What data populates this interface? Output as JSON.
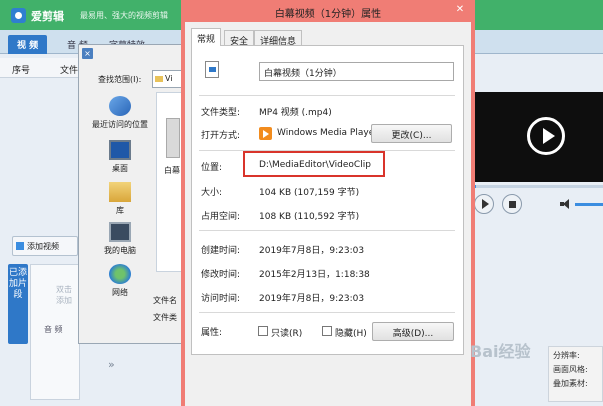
{
  "app": {
    "name": "爱剪辑",
    "slogan": "最易用、强大的视频剪辑",
    "tabs": [
      "视 频",
      "音 频",
      "字幕特效"
    ],
    "columns": {
      "seq": "序号",
      "file": "文件"
    },
    "add_video": "添加视频",
    "added_clips": "已添加片段",
    "dblclick_hint": "双击 添加",
    "audio_label": "音 频",
    "expand_arrows": "»",
    "info_rows": [
      "分辨率:",
      "画面风格:",
      "叠加素材:"
    ]
  },
  "open_dialog": {
    "lookin_label": "查找范围(I):",
    "lookin_value": "Vi",
    "places": [
      {
        "label": "最近访问的位置",
        "icon": "recent-places-icon"
      },
      {
        "label": "桌面",
        "icon": "desktop-icon"
      },
      {
        "label": "库",
        "icon": "library-icon"
      },
      {
        "label": "我的电脑",
        "icon": "computer-icon"
      },
      {
        "label": "网络",
        "icon": "network-icon"
      }
    ],
    "file_thumb_name": "白幕",
    "filename_label": "文件名",
    "filetype_label": "文件类"
  },
  "properties": {
    "title": "白幕视频（1分钟）属性",
    "tabs": [
      "常规",
      "安全",
      "详细信息"
    ],
    "file_name": "白幕视频（1分钟）",
    "file_type_label": "文件类型:",
    "file_type": "MP4 视频 (.mp4)",
    "opens_with_label": "打开方式:",
    "opens_with": "Windows Media Playe",
    "change_button": "更改(C)...",
    "location_label": "位置:",
    "location": "D:\\MediaEditor\\VideoClip",
    "size_label": "大小:",
    "size": "104 KB (107,159 字节)",
    "size_on_disk_label": "占用空间:",
    "size_on_disk": "108 KB (110,592 字节)",
    "created_label": "创建时间:",
    "created": "2019年7月8日，9:23:03",
    "modified_label": "修改时间:",
    "modified": "2015年2月13日，1:18:38",
    "accessed_label": "访问时间:",
    "accessed": "2019年7月8日，9:23:03",
    "attributes_label": "属性:",
    "readonly_label": "只读(R)",
    "hidden_label": "隐藏(H)",
    "advanced_button": "高级(D)...",
    "close_glyph": "✕"
  },
  "watermark": "Bai经验",
  "colors": {
    "app_green": "#41b16a",
    "tab_blue": "#2f78c8",
    "dialog_accent": "#f07d75",
    "highlight_red": "#d9342b"
  }
}
